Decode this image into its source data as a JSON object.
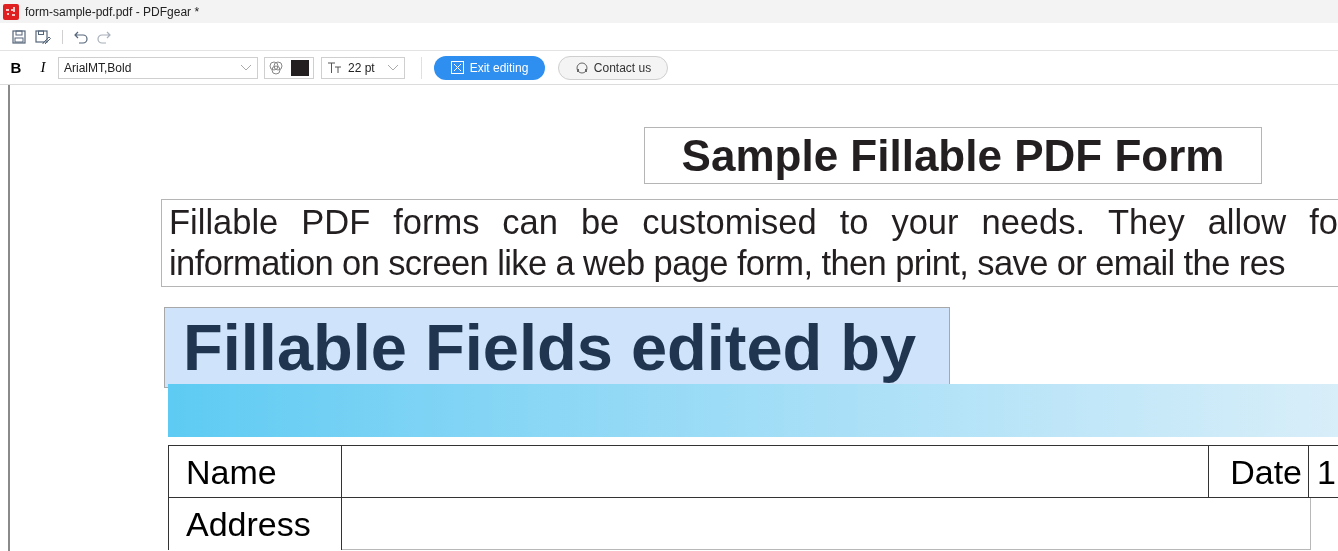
{
  "window": {
    "title": "form-sample-pdf.pdf - PDFgear *"
  },
  "format_bar": {
    "bold": "B",
    "italic": "I",
    "font": "ArialMT,Bold",
    "font_size": "22 pt",
    "exit_button": "Exit editing",
    "contact_button": "Contact us"
  },
  "document": {
    "title": "Sample Fillable PDF Form",
    "paragraph_lines": [
      "Fillable PDF forms can be customised to your needs. They allow fo",
      "information on screen like a web page form, then print, save or email the res"
    ],
    "heading": {
      "text": "Fillable Fields edited by",
      "selected": true
    },
    "table": {
      "rows": [
        [
          "Name",
          "",
          "Date",
          "1"
        ],
        [
          "Address",
          ""
        ]
      ]
    }
  }
}
